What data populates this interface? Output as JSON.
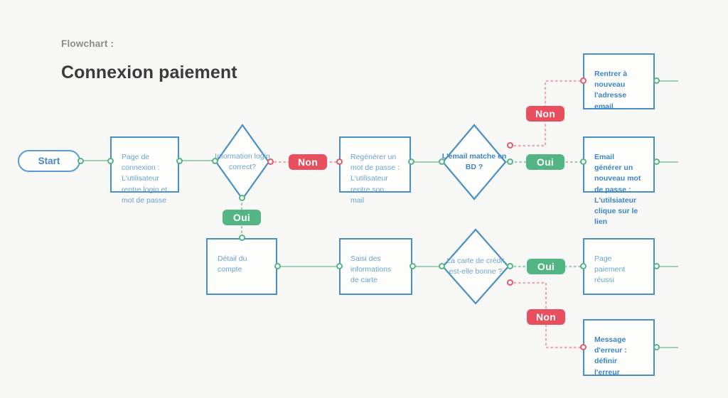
{
  "header": {
    "kicker": "Flowchart :",
    "title": "Connexion paiement"
  },
  "colors": {
    "background": "#f7f7f5",
    "node_border": "#4a8fc4",
    "node_text": "#6fa3d0",
    "node_text_bold": "#3d85c6",
    "yes_badge": "#53b584",
    "no_badge": "#e8505f",
    "yes_link": "#9ed0b4",
    "no_link": "#eeaab4"
  },
  "nodes": {
    "start": {
      "label": "Start",
      "shape": "terminator"
    },
    "login_page": {
      "label": "Page de connexion  : L'utilisateur rentre login et mot de passe",
      "shape": "process"
    },
    "login_check": {
      "label": "Information login correct?",
      "shape": "decision"
    },
    "regen_password": {
      "label": "Regénérer un mot de passe : L'utilisateur rentre son mail",
      "shape": "process"
    },
    "email_match": {
      "label": "L'email matche en BD ?",
      "shape": "decision"
    },
    "reenter_email": {
      "label": "Rentrer à nouveau l'adresse email",
      "shape": "process"
    },
    "email_generated": {
      "label": "Email  générer un nouveau mot de passe : L'utilsiateur clique sur le lien",
      "shape": "process"
    },
    "account_detail": {
      "label": "Détail du compte",
      "shape": "process"
    },
    "card_info": {
      "label": "Saisi des informations de carte",
      "shape": "process"
    },
    "card_valid": {
      "label": "La carte de crédit est-elle bonne ?",
      "shape": "decision"
    },
    "payment_success": {
      "label": "Page paiement réussi",
      "shape": "process"
    },
    "error_message": {
      "label": "Message d'erreur : définir l'erreur",
      "shape": "process"
    }
  },
  "edge_labels": {
    "login_no": "Non",
    "login_yes": "Oui",
    "email_no": "Non",
    "email_yes": "Oui",
    "card_yes": "Oui",
    "card_no": "Non"
  }
}
